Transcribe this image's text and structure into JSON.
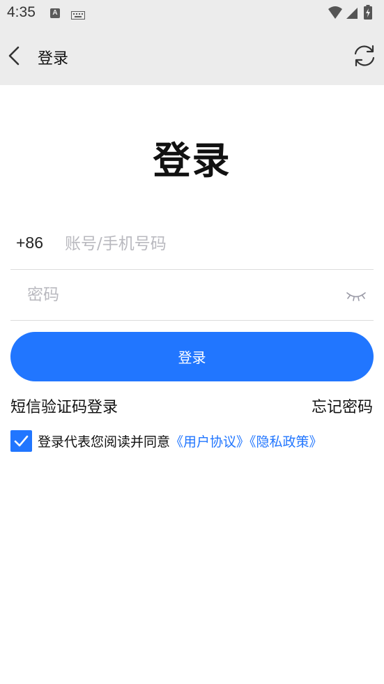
{
  "status_bar": {
    "time": "4:35",
    "notification_icon_letter": "A"
  },
  "app_bar": {
    "title": "登录"
  },
  "page": {
    "heading": "登录"
  },
  "form": {
    "country_code": "+86",
    "account_placeholder": "账号/手机号码",
    "password_placeholder": "密码",
    "login_button_label": "登录"
  },
  "links": {
    "sms_login": "短信验证码登录",
    "forgot_password": "忘记密码"
  },
  "agreement": {
    "checked": true,
    "prefix_text": "登录代表您阅读并同意",
    "user_agreement": "《用户协议》",
    "privacy_policy": "《隐私政策》"
  },
  "colors": {
    "accent": "#2176ff",
    "bar_background": "#ececec"
  },
  "icons": {
    "back": "back-arrow-icon",
    "refresh": "refresh-icon",
    "password_visibility": "eye-closed-icon",
    "wifi": "wifi-icon",
    "signal": "cell-signal-icon",
    "battery": "battery-charging-icon",
    "keyboard": "keyboard-icon",
    "check": "check-icon"
  }
}
